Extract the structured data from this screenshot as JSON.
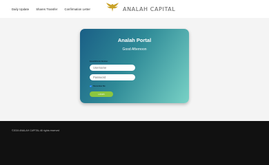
{
  "nav": {
    "items": [
      "Daily Update",
      "Shares Transfer",
      "Confirmation Letter"
    ]
  },
  "brand": {
    "name": "ANALAH CAPITAL",
    "logo_icon": "eagle-logo",
    "logo_color": "#c9a227"
  },
  "login": {
    "title": "Analah Portal",
    "greeting": "Good Afternoon",
    "field_label": "Email/Mobile Number",
    "username_placeholder": "Username",
    "password_placeholder": "Password",
    "remember_label": "Remember Me",
    "button_label": "LOGIN",
    "button_color": "#8cc63f"
  },
  "footer": {
    "copyright": "©2024 ANALAH CAPITAL All rights reserved"
  }
}
